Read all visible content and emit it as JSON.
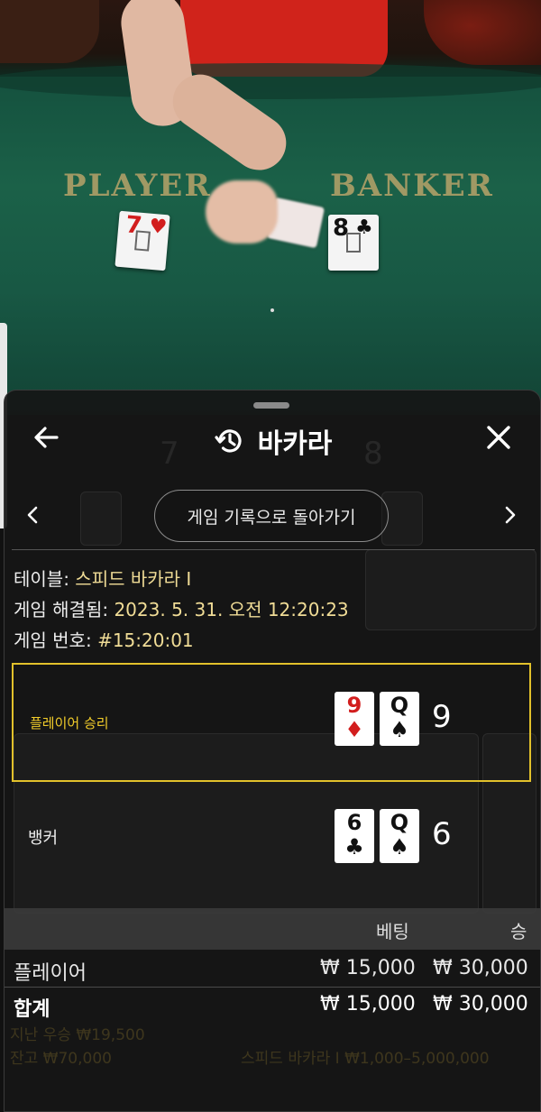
{
  "video": {
    "player_label": "PLAYER",
    "banker_label": "BANKER",
    "player_card": {
      "rank": "7",
      "suit": "♥"
    },
    "banker_card": {
      "rank": "8",
      "suit": "♣"
    }
  },
  "header": {
    "title": "바카라",
    "back_icon": "arrow-left-icon",
    "history_icon": "history-clock-icon",
    "close_icon": "close-icon"
  },
  "nav": {
    "history_button_label": "게임 기록으로 돌아가기"
  },
  "info": {
    "table_label": "테이블: ",
    "table_value": "스피드 바카라 I",
    "resolved_label": "게임 해결됨: ",
    "resolved_value": "2023. 5. 31. 오전 12:20:23",
    "game_number_label": "게임 번호: ",
    "game_number_value": "#15:20:01"
  },
  "result": {
    "player": {
      "label": "플레이어 승리",
      "cards": [
        {
          "rank": "9",
          "suit": "♦",
          "color": "#d21e1e"
        },
        {
          "rank": "Q",
          "suit": "♠",
          "color": "#111111"
        }
      ],
      "score": "9"
    },
    "banker": {
      "label": "뱅커",
      "cards": [
        {
          "rank": "6",
          "suit": "♣",
          "color": "#111111"
        },
        {
          "rank": "Q",
          "suit": "♠",
          "color": "#111111"
        }
      ],
      "score": "6"
    }
  },
  "bets": {
    "columns": {
      "bet": "베팅",
      "win": "승"
    },
    "rows": [
      {
        "name": "플레이어",
        "bet": "₩ 15,000",
        "win": "₩ 30,000"
      }
    ],
    "total": {
      "name": "합계",
      "bet": "₩ 15,000",
      "win": "₩ 30,000"
    }
  },
  "background_faded": {
    "last_win": "지난 우승 ₩19,500",
    "balance": "잔고 ₩70,000",
    "table_limits": "스피드 바카라 I ₩1,000–5,000,000"
  },
  "colors": {
    "accent_gold": "#e2c12b",
    "info_value": "#f0dc96",
    "felt_green": "#1b6148",
    "sheet_bg": "#161616"
  }
}
